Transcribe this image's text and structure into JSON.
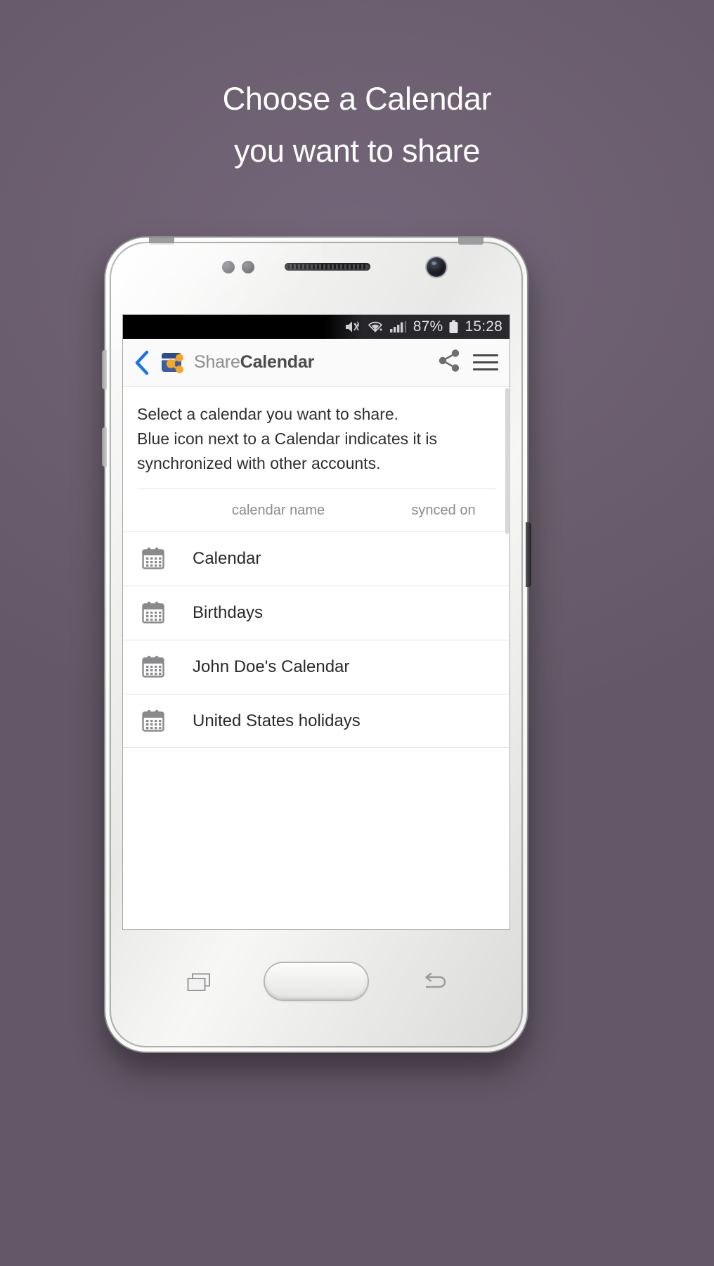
{
  "headline": {
    "line1": "Choose a Calendar",
    "line2": "you want to share"
  },
  "colors": {
    "background": "#6b5e6e",
    "accent_blue": "#1a73e8",
    "logo_blue": "#3a5ca8",
    "logo_orange": "#f5a623",
    "statusbar": "#111113",
    "text_primary": "#2a2a2c",
    "text_muted": "#8b8b8d"
  },
  "status_bar": {
    "mute_icon": "mute-icon",
    "wifi_icon": "wifi-icon",
    "signal_icon": "signal-bars-icon",
    "battery_percent": "87%",
    "battery_icon": "battery-icon",
    "time": "15:28"
  },
  "toolbar": {
    "back_icon": "back-chevron-icon",
    "logo_icon": "sharecalendar-logo-icon",
    "brand_light": "Share",
    "brand_bold": "Calendar",
    "share_icon": "share-icon",
    "menu_icon": "hamburger-menu-icon"
  },
  "content": {
    "intro_line1": "Select a calendar you want to share.",
    "intro_line2": "Blue icon next to a Calendar indicates it is",
    "intro_line3": "synchronized with other accounts.",
    "columns": {
      "name": "calendar name",
      "synced": "synced on"
    },
    "calendars": [
      {
        "name": "Calendar",
        "icon": "calendar-icon",
        "synced": ""
      },
      {
        "name": "Birthdays",
        "icon": "calendar-icon",
        "synced": ""
      },
      {
        "name": "John Doe's Calendar",
        "icon": "calendar-icon",
        "synced": ""
      },
      {
        "name": "United States holidays",
        "icon": "calendar-icon",
        "synced": ""
      }
    ]
  },
  "device_nav": {
    "recents_icon": "recents-icon",
    "home_button": "home-button",
    "back_icon": "back-icon"
  }
}
